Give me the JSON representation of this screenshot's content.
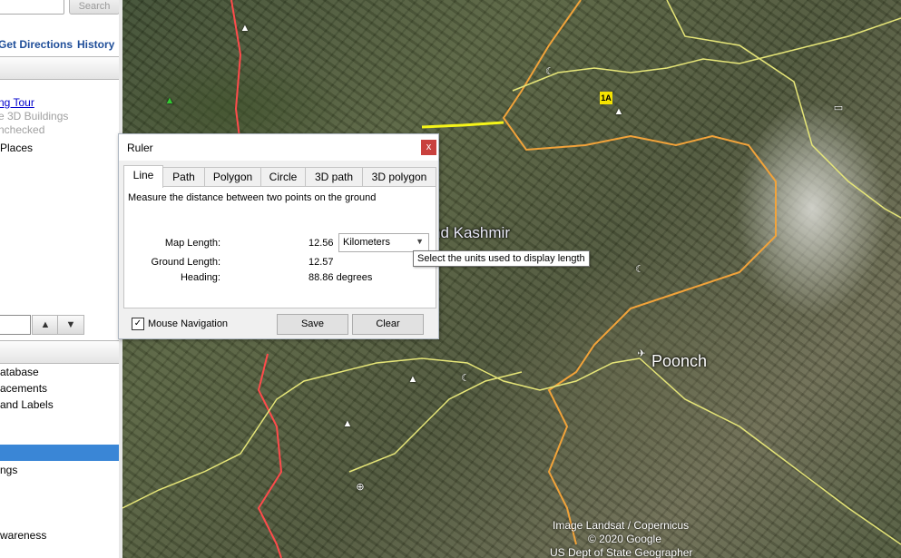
{
  "sidebar": {
    "search_button": "Search",
    "get_directions": "Get Directions",
    "history": "History",
    "layers": {
      "tour": "ng Tour",
      "buildings": "e 3D Buildings",
      "unchecked": "nchecked",
      "places": "Places"
    },
    "nav_up": "▲",
    "nav_down": "▼",
    "db_items": {
      "database": "atabase",
      "placements": "acements",
      "labels": "and Labels",
      "ings": "ngs",
      "awareness": "wareness"
    }
  },
  "map": {
    "region_label": "nd Kashmir",
    "city_label": "Poonch",
    "attribution": {
      "image": "Image Landsat / Copernicus",
      "copyright": "© 2020 Google",
      "geographer": "US Dept of State Geographer"
    },
    "colors": {
      "international_border": "#f2a33a",
      "lines": "#e6e678",
      "highway": "#ff4b4b",
      "yellow_road": "#f5f519"
    }
  },
  "ruler": {
    "title": "Ruler",
    "close": "x",
    "tabs": [
      "Line",
      "Path",
      "Polygon",
      "Circle",
      "3D path",
      "3D polygon"
    ],
    "description": "Measure the distance between two points on the ground",
    "map_length_label": "Map Length:",
    "map_length_value": "12.56",
    "unit": "Kilometers",
    "ground_length_label": "Ground Length:",
    "ground_length_value": "12.57",
    "heading_label": "Heading:",
    "heading_value": "88.86 degrees",
    "mouse_navigation": "Mouse Navigation",
    "mouse_navigation_checked": true,
    "save": "Save",
    "clear": "Clear",
    "tooltip": "Select the units used to display length"
  }
}
